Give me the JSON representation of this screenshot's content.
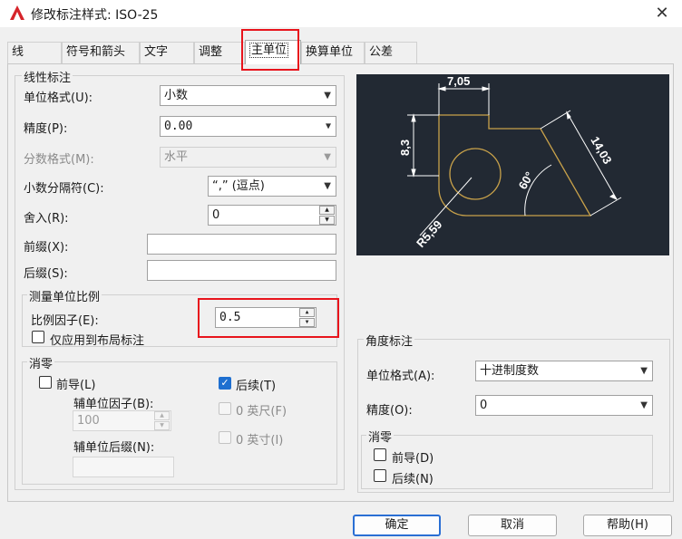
{
  "window": {
    "title": "修改标注样式: ISO-25",
    "close_glyph": "✕",
    "app_logo_letter": "A"
  },
  "tabs": [
    "线",
    "符号和箭头",
    "文字",
    "调整",
    "主单位",
    "换算单位",
    "公差"
  ],
  "active_tab": "主单位",
  "linear": {
    "group_title": "线性标注",
    "unit_format_label": "单位格式(U):",
    "unit_format_value": "小数",
    "precision_label": "精度(P):",
    "precision_value": "0.00",
    "fraction_format_label": "分数格式(M):",
    "fraction_format_value": "水平",
    "decimal_sep_label": "小数分隔符(C):",
    "decimal_sep_value": "“,” (逗点)",
    "round_label": "舍入(R):",
    "round_value": "0",
    "prefix_label": "前缀(X):",
    "prefix_value": "",
    "suffix_label": "后缀(S):",
    "suffix_value": ""
  },
  "measure_scale": {
    "group_title": "测量单位比例",
    "factor_label": "比例因子(E):",
    "factor_value": "0.5",
    "layout_only_label": "仅应用到布局标注",
    "layout_only_checked": false
  },
  "zero_suppress": {
    "group_title": "消零",
    "leading_label": "前导(L)",
    "leading_checked": false,
    "trailing_label": "后续(T)",
    "trailing_checked": true,
    "sub_unit_factor_label": "辅单位因子(B):",
    "sub_unit_factor_value": "100",
    "sub_unit_suffix_label": "辅单位后缀(N):",
    "sub_unit_suffix_value": "",
    "feet_label": "0 英尺(F)",
    "inches_label": "0 英寸(I)"
  },
  "angular": {
    "group_title": "角度标注",
    "unit_format_label": "单位格式(A):",
    "unit_format_value": "十进制度数",
    "precision_label": "精度(O):",
    "precision_value": "0",
    "zero_group_title": "消零",
    "leading_label": "前导(D)",
    "trailing_label": "后续(N)"
  },
  "preview": {
    "dim_top": "7,05",
    "dim_left": "8,3",
    "dim_diag": "14,03",
    "dim_angle": "60°",
    "dim_radius": "R5,59"
  },
  "buttons": {
    "ok": "确定",
    "cancel": "取消",
    "help": "帮助(H)"
  },
  "colors": {
    "highlight_box": "#e8141c",
    "preview_bg": "#222933",
    "preview_geometry": "#c9a24a",
    "default_button_border": "#2a6fd4"
  }
}
